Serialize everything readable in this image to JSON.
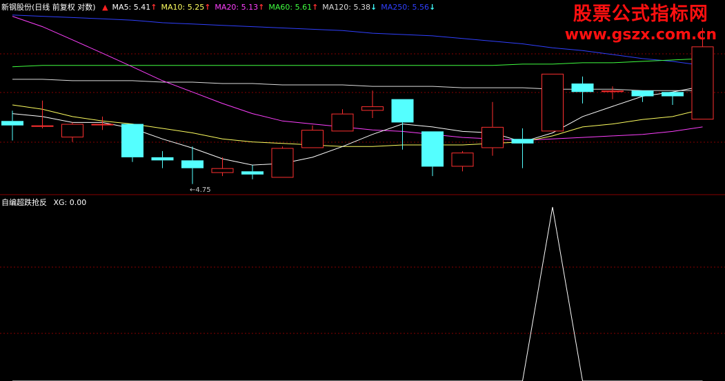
{
  "header": {
    "title": "新钢股份(日线 前复权 对数)",
    "ma_items": [
      {
        "label": "MA5:",
        "value": "5.41",
        "arrow": "↑",
        "color": "#ffffff",
        "arrow_color": "#ff3030"
      },
      {
        "label": "MA10:",
        "value": "5.25",
        "arrow": "↑",
        "color": "#ffff60",
        "arrow_color": "#ff3030"
      },
      {
        "label": "MA20:",
        "value": "5.13",
        "arrow": "↑",
        "color": "#ff40ff",
        "arrow_color": "#ff3030"
      },
      {
        "label": "MA60:",
        "value": "5.61",
        "arrow": "↑",
        "color": "#40ff40",
        "arrow_color": "#ff3030"
      },
      {
        "label": "MA120:",
        "value": "5.38",
        "arrow": "↓",
        "color": "#dcdcdc",
        "arrow_color": "#40ffff"
      },
      {
        "label": "MA250:",
        "value": "5.56",
        "arrow": "↓",
        "color": "#3040ff",
        "arrow_color": "#40ffff"
      }
    ],
    "lead_arrow": "🡅"
  },
  "watermark": {
    "cn": "股票公式指标网",
    "url": "www.gszx.com.cn"
  },
  "indicator": {
    "title": "自编超跌抢反",
    "value_label": "XG:",
    "value": "0.00"
  },
  "chart_data": {
    "type": "candlestick",
    "low_label": "4.75",
    "colors": {
      "up": "#ff3030",
      "down": "#54ffff",
      "ma5": "#ffffff",
      "ma10": "#ffff60",
      "ma20": "#ff40ff",
      "ma60": "#40ff40",
      "ma120": "#dcdcdc",
      "ma250": "#3040ff",
      "grid": "#8a0000",
      "signal": "#ffffff"
    },
    "candles": [
      {
        "o": 5.17,
        "h": 5.24,
        "l": 5.04,
        "c": 5.14
      },
      {
        "o": 5.14,
        "h": 5.31,
        "l": 5.12,
        "c": 5.14
      },
      {
        "o": 5.06,
        "h": 5.16,
        "l": 5.03,
        "c": 5.15
      },
      {
        "o": 5.15,
        "h": 5.2,
        "l": 5.11,
        "c": 5.15
      },
      {
        "o": 5.15,
        "h": 5.15,
        "l": 4.9,
        "c": 4.93
      },
      {
        "o": 4.93,
        "h": 4.97,
        "l": 4.86,
        "c": 4.91
      },
      {
        "o": 4.91,
        "h": 5.0,
        "l": 4.76,
        "c": 4.86
      },
      {
        "o": 4.83,
        "h": 4.93,
        "l": 4.81,
        "c": 4.86
      },
      {
        "o": 4.84,
        "h": 4.88,
        "l": 4.79,
        "c": 4.82
      },
      {
        "o": 4.8,
        "h": 5.0,
        "l": 4.8,
        "c": 4.99
      },
      {
        "o": 4.99,
        "h": 5.14,
        "l": 4.99,
        "c": 5.11
      },
      {
        "o": 5.1,
        "h": 5.25,
        "l": 5.1,
        "c": 5.22
      },
      {
        "o": 5.24,
        "h": 5.38,
        "l": 5.19,
        "c": 5.27
      },
      {
        "o": 5.32,
        "h": 5.32,
        "l": 4.98,
        "c": 5.16
      },
      {
        "o": 5.1,
        "h": 5.1,
        "l": 4.81,
        "c": 4.87
      },
      {
        "o": 4.87,
        "h": 4.97,
        "l": 4.84,
        "c": 4.96
      },
      {
        "o": 4.99,
        "h": 5.3,
        "l": 4.94,
        "c": 5.13
      },
      {
        "o": 5.05,
        "h": 5.12,
        "l": 4.86,
        "c": 5.02
      },
      {
        "o": 5.1,
        "h": 5.5,
        "l": 5.1,
        "c": 5.5
      },
      {
        "o": 5.43,
        "h": 5.48,
        "l": 5.29,
        "c": 5.37
      },
      {
        "o": 5.37,
        "h": 5.41,
        "l": 5.32,
        "c": 5.38
      },
      {
        "o": 5.38,
        "h": 5.38,
        "l": 5.3,
        "c": 5.34
      },
      {
        "o": 5.37,
        "h": 5.37,
        "l": 5.28,
        "c": 5.34
      },
      {
        "o": 5.18,
        "h": 5.84,
        "l": 5.18,
        "c": 5.7
      }
    ],
    "ma5": [
      5.22,
      5.2,
      5.16,
      5.16,
      5.12,
      5.05,
      4.99,
      4.92,
      4.88,
      4.89,
      4.93,
      5.0,
      5.08,
      5.15,
      5.13,
      5.1,
      5.09,
      5.03,
      5.09,
      5.2,
      5.27,
      5.34,
      5.37,
      5.41
    ],
    "ma10": [
      5.28,
      5.25,
      5.2,
      5.17,
      5.15,
      5.12,
      5.09,
      5.05,
      5.03,
      5.02,
      5.01,
      5.0,
      5.0,
      5.01,
      5.01,
      5.01,
      5.02,
      5.03,
      5.07,
      5.13,
      5.15,
      5.18,
      5.2,
      5.25
    ],
    "ma20": [
      5.93,
      5.85,
      5.75,
      5.65,
      5.55,
      5.45,
      5.37,
      5.29,
      5.22,
      5.17,
      5.15,
      5.13,
      5.11,
      5.1,
      5.08,
      5.06,
      5.05,
      5.04,
      5.05,
      5.06,
      5.07,
      5.08,
      5.1,
      5.13
    ],
    "ma60": [
      5.55,
      5.56,
      5.56,
      5.56,
      5.56,
      5.56,
      5.56,
      5.56,
      5.56,
      5.56,
      5.56,
      5.56,
      5.56,
      5.56,
      5.56,
      5.56,
      5.56,
      5.57,
      5.57,
      5.58,
      5.58,
      5.59,
      5.6,
      5.61
    ],
    "ma120": [
      5.46,
      5.46,
      5.45,
      5.45,
      5.45,
      5.44,
      5.44,
      5.43,
      5.43,
      5.42,
      5.42,
      5.42,
      5.41,
      5.41,
      5.41,
      5.4,
      5.4,
      5.4,
      5.39,
      5.39,
      5.39,
      5.38,
      5.38,
      5.38
    ],
    "ma250": [
      5.94,
      5.93,
      5.92,
      5.91,
      5.9,
      5.88,
      5.87,
      5.86,
      5.85,
      5.84,
      5.83,
      5.82,
      5.8,
      5.79,
      5.78,
      5.76,
      5.74,
      5.72,
      5.69,
      5.67,
      5.64,
      5.61,
      5.59,
      5.56
    ],
    "xg": [
      0,
      0,
      0,
      0,
      0,
      0,
      0,
      0,
      0,
      0,
      0,
      0,
      0,
      0,
      0,
      0,
      0,
      0,
      1,
      0,
      0,
      0,
      0,
      0
    ]
  }
}
